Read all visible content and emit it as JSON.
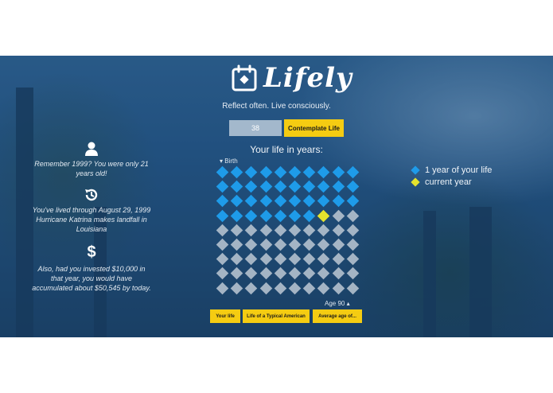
{
  "app": {
    "name": "Lifely",
    "tagline": "Reflect often. Live consciously."
  },
  "form": {
    "age_value": "38",
    "contemplate_label": "Contemplate Life"
  },
  "grid": {
    "title": "Your life in years:",
    "start_label": "Birth",
    "end_label": "Age 90",
    "total_years": 90,
    "current_age": 38,
    "columns": 10
  },
  "legend": {
    "lived_label": "1 year of your life",
    "current_label": "current year"
  },
  "facts": [
    {
      "icon": "person-icon",
      "text": "Remember 1999? You were only 21 years old!"
    },
    {
      "icon": "history-icon",
      "text": "You've lived through August 29, 1999 Hurricane Katrina makes landfall in Louisiana"
    },
    {
      "icon": "dollar-icon",
      "text": "Also, had you invested $10,000 in that year, you would have accumulated about $50,545 by today."
    }
  ],
  "buttons": {
    "your_life": "Your life",
    "typical_american": "Life of a Typical American",
    "average_age": "Average age of..."
  },
  "colors": {
    "lived": "#1e9be9",
    "current": "#e5e32d",
    "future": "#bcc8d4",
    "accent": "#f5cc12"
  }
}
